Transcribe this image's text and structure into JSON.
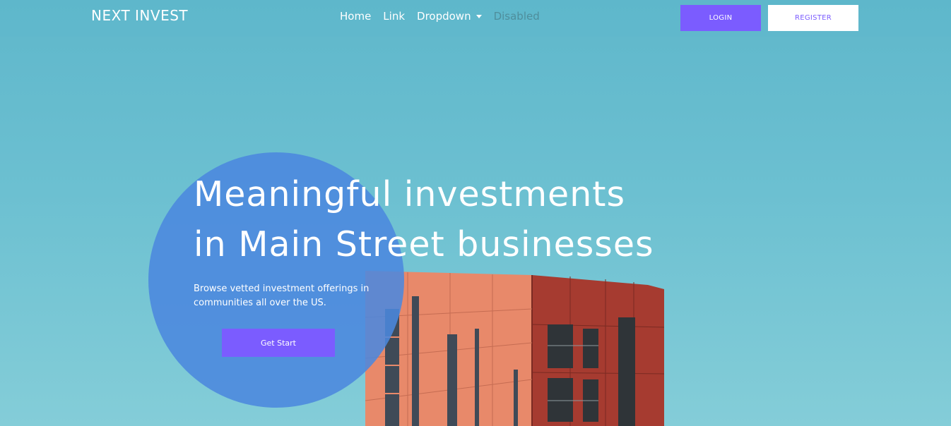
{
  "nav": {
    "brand": "NEXT INVEST",
    "links": [
      {
        "label": "Home",
        "state": "active"
      },
      {
        "label": "Link",
        "state": "normal"
      },
      {
        "label": "Dropdown",
        "state": "dropdown"
      },
      {
        "label": "Disabled",
        "state": "disabled"
      }
    ],
    "login_label": "LOGIN",
    "register_label": "REGISTER"
  },
  "hero": {
    "headline_line1": "Meaningful investments",
    "headline_line2": "in Main Street businesses",
    "subtitle": "Browse vetted investment offerings in communities all over the US.",
    "cta_label": "Get Start",
    "image": "red-brick-apartment-building"
  },
  "colors": {
    "sky": "#6cc0d1",
    "accent": "#7b5cff",
    "circle": "#4b88de",
    "building_left": "#e8896a",
    "building_right": "#a63b30"
  }
}
